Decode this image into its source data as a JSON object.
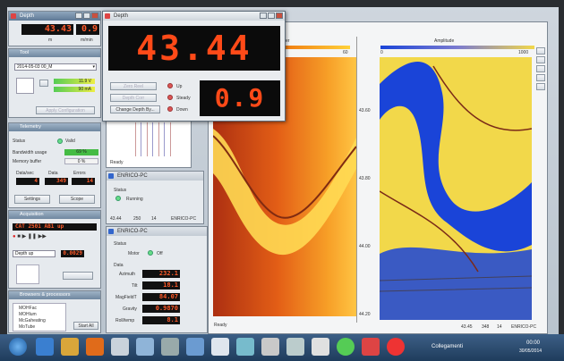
{
  "top_left_panel": {
    "title": "Depth",
    "value_main": "43.43",
    "value_secondary": "0.9",
    "unit_left": "m",
    "unit_right": "m/min"
  },
  "depth_window": {
    "title": "Depth",
    "big_value": "43.44",
    "small_value": "0.9",
    "buttons": [
      "Zero Reel",
      "Depth Corr",
      "Change Depth By..."
    ],
    "indicators": [
      "Up",
      "Steady",
      "Down"
    ]
  },
  "left_sidebar": {
    "tool_section": "Tool",
    "tool_select": "2014-05-03 00_M",
    "tool_gauges": [
      "11.9 V",
      "90 mA"
    ],
    "apply_button": "Apply Configuration",
    "telemetry": {
      "title": "Telemetry",
      "status_label": "Status",
      "status_value": "Valid",
      "bandwidth_label": "Bandwidth usage",
      "bandwidth_value": "69 %",
      "memory_label": "Memory buffer",
      "memory_value": "0 %",
      "col_headers": [
        "Data/sec",
        "Data",
        "Errors"
      ],
      "col_values": [
        "4",
        "349",
        "14"
      ],
      "settings_button": "Settings",
      "scope_button": "Scope"
    },
    "acquisition": {
      "title": "Acquisition",
      "file_display": "CAT 2501 AB1 up",
      "mode": "Depth up",
      "step": "0.0029"
    },
    "browsers": {
      "title": "Browsers & processors",
      "items": [
        "MOHFac",
        "MOHlum",
        "McGaheating",
        "MoTube"
      ],
      "start_button": "Start All"
    }
  },
  "plot_windows": {
    "upper_status": "Ready",
    "enrico_status_title": "ENRICO-PC",
    "enrico_status": "Running",
    "enrico_footer": [
      "43.44",
      "250",
      "14",
      "ENRICO-PC"
    ],
    "status2_label": "Status",
    "motor_label": "Motor",
    "motor_value": "Off",
    "data_label": "Data",
    "data_rows": [
      {
        "label": "Azimuth",
        "value": "232.1"
      },
      {
        "label": "Tilt",
        "value": "18.1"
      },
      {
        "label": "MagFieldT",
        "value": "84.07"
      },
      {
        "label": "Gravity",
        "value": "0.9870"
      },
      {
        "label": "Roll/temp",
        "value": "8.1"
      }
    ]
  },
  "main_window": {
    "left_header": "er",
    "left_scale": [
      "0",
      "60"
    ],
    "right_header": "Amplitude",
    "right_scale": [
      "0",
      "1000"
    ],
    "depth_ticks": [
      "43.60",
      "43.80",
      "44.00",
      "44.20"
    ],
    "left_status": "Ready",
    "right_footer": [
      "43.45",
      "348",
      "14",
      "ENRICO-PC"
    ]
  },
  "taskbar": {
    "language": "Collegamenti",
    "tray_time": "00:00",
    "tray_date": "30/05/2014"
  },
  "colors": {
    "led": "#ff4a18",
    "titlebar": "#5f7a96",
    "heat_dark": "#c43a08",
    "heat_light": "#ffd23a",
    "amp_blue": "#1a44d8",
    "amp_yellow": "#f2d84a"
  }
}
